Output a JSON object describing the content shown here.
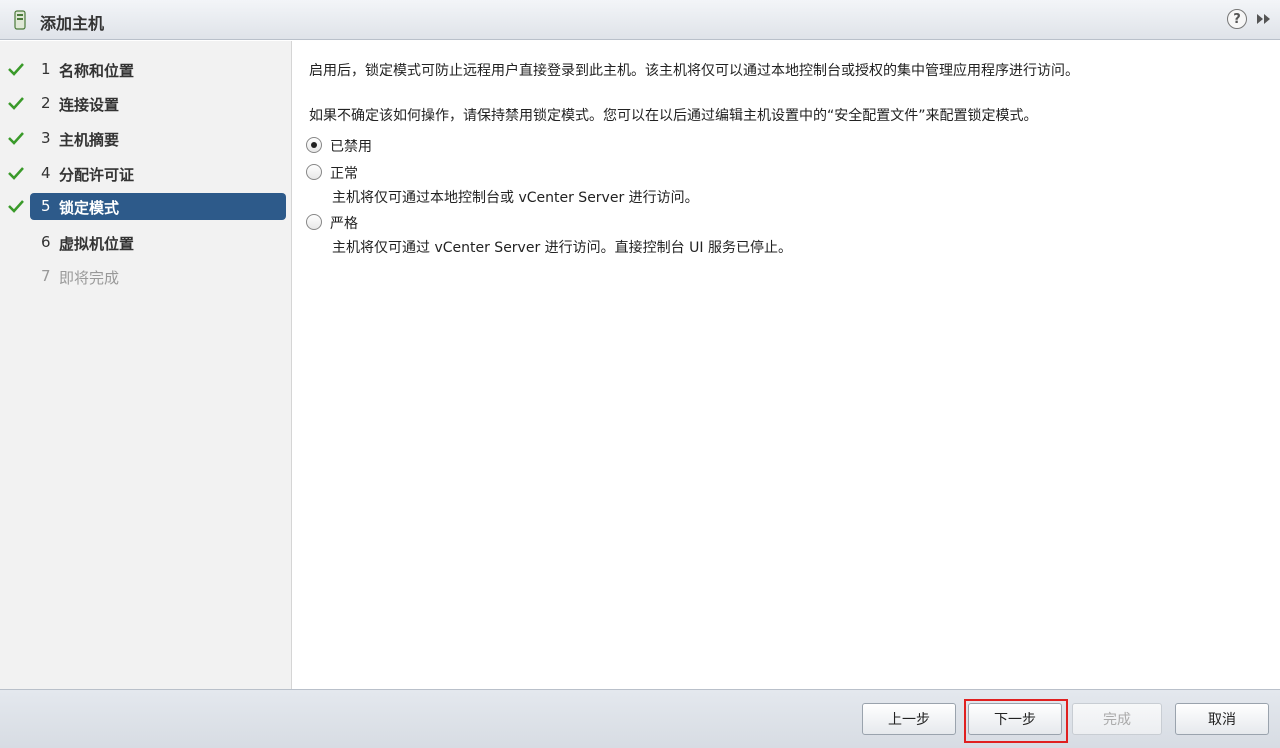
{
  "window": {
    "title": "添加主机",
    "help_icon": "?",
    "colors": {
      "accent": "#2d5a8a",
      "check": "#3a9a2a",
      "highlight_box": "#e02020"
    }
  },
  "steps": [
    {
      "num": "1",
      "label": "名称和位置",
      "state": "done"
    },
    {
      "num": "2",
      "label": "连接设置",
      "state": "done"
    },
    {
      "num": "3",
      "label": "主机摘要",
      "state": "done"
    },
    {
      "num": "4",
      "label": "分配许可证",
      "state": "done"
    },
    {
      "num": "5",
      "label": "锁定模式",
      "state": "active"
    },
    {
      "num": "6",
      "label": "虚拟机位置",
      "state": "pending"
    },
    {
      "num": "7",
      "label": "即将完成",
      "state": "disabled"
    }
  ],
  "content": {
    "intro": "启用后，锁定模式可防止远程用户直接登录到此主机。该主机将仅可以通过本地控制台或授权的集中管理应用程序进行访问。",
    "hint": "如果不确定该如何操作，请保持禁用锁定模式。您可以在以后通过编辑主机设置中的“安全配置文件”来配置锁定模式。",
    "options": [
      {
        "label": "已禁用",
        "desc": "",
        "checked": true
      },
      {
        "label": "正常",
        "desc": "主机将仅可通过本地控制台或 vCenter Server 进行访问。",
        "checked": false
      },
      {
        "label": "严格",
        "desc": "主机将仅可通过 vCenter Server 进行访问。直接控制台 UI 服务已停止。",
        "checked": false
      }
    ]
  },
  "footer": {
    "back_label": "上一步",
    "next_label": "下一步",
    "finish_label": "完成",
    "cancel_label": "取消"
  }
}
